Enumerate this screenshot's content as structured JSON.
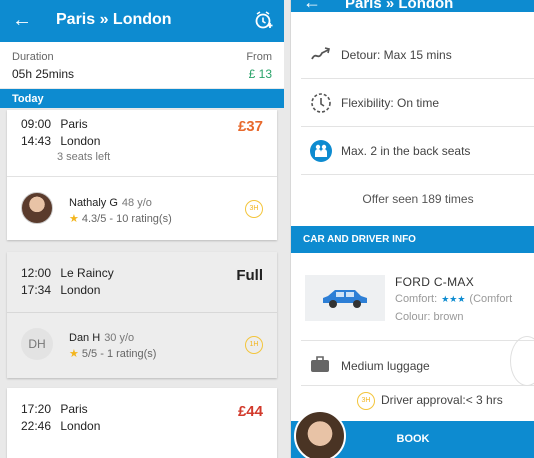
{
  "left": {
    "header": {
      "title": "Paris » London"
    },
    "summary": {
      "duration_label": "Duration",
      "duration_value": "05h 25mins",
      "from_label": "From",
      "from_value": "£ 13"
    },
    "section_label": "Today",
    "trips": [
      {
        "dep_time": "09:00",
        "dep_city": "Paris",
        "arr_time": "14:43",
        "arr_city": "London",
        "price": "£37",
        "seats": "3 seats left",
        "driver_name": "Nathaly G",
        "driver_age": "48 y/o",
        "rating": "4.3/5 - 10 rating(s)",
        "approval": "3H"
      },
      {
        "dep_time": "12:00",
        "dep_city": "Le Raincy",
        "arr_time": "17:34",
        "arr_city": "London",
        "price": "Full",
        "driver_initials": "DH",
        "driver_name": "Dan H",
        "driver_age": "30 y/o",
        "rating": "5/5 - 1 rating(s)",
        "approval": "1H"
      },
      {
        "dep_time": "17:20",
        "dep_city": "Paris",
        "arr_time": "22:46",
        "arr_city": "London",
        "price": "£44"
      }
    ]
  },
  "right": {
    "header": {
      "title": "Paris » London"
    },
    "detour": "Detour: Max 15 mins",
    "flexibility": "Flexibility: On time",
    "back_seats": "Max. 2 in the back seats",
    "offer_seen": "Offer seen 189 times",
    "section": "CAR AND DRIVER INFO",
    "car": {
      "model": "FORD C-MAX",
      "comfort_label": "Comfort:",
      "comfort_stars": "★★★",
      "comfort_text": "(Comfort",
      "colour": "Colour: brown"
    },
    "luggage": "Medium luggage",
    "approval_badge": "3H",
    "approval": "Driver approval:< 3 hrs",
    "book": "BOOK"
  },
  "colors": {
    "brand": "#0d8bd0",
    "price_orange": "#e8692c",
    "price_red": "#d23a2c",
    "green": "#2aa36a",
    "star": "#f3b51d"
  }
}
